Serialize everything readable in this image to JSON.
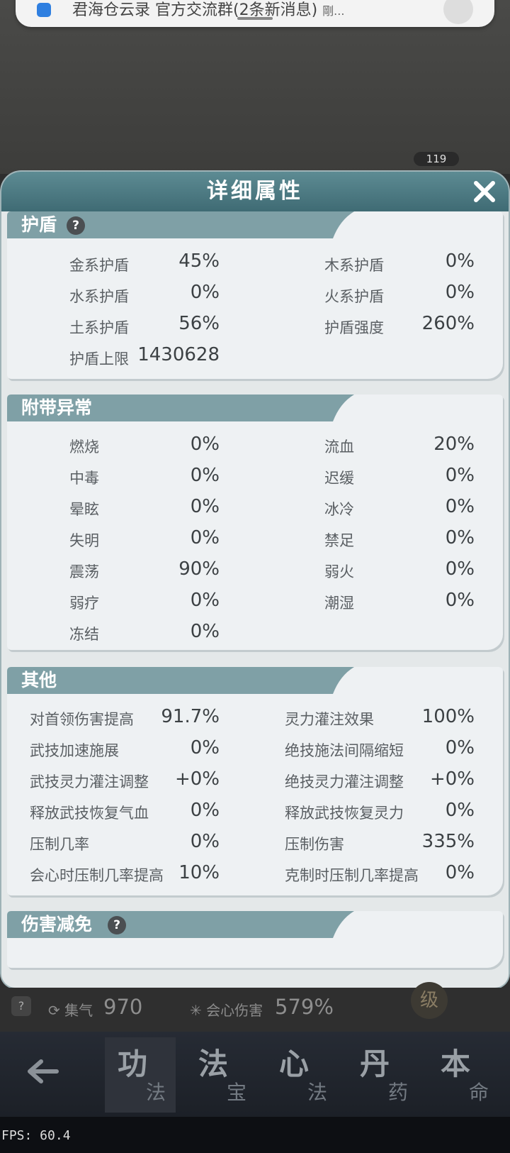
{
  "notification": {
    "text": "君海仓云录 官方交流群(2条新消息)",
    "suffix": "剛..."
  },
  "scene": {
    "badge_count": "119"
  },
  "panel": {
    "title": "详细属性",
    "close_icon": "close-icon"
  },
  "shield": {
    "title": "护盾",
    "help": "?",
    "left": [
      {
        "label": "金系护盾",
        "value": "45%"
      },
      {
        "label": "水系护盾",
        "value": "0%"
      },
      {
        "label": "土系护盾",
        "value": "56%"
      },
      {
        "label": "护盾上限",
        "value": "1430628"
      }
    ],
    "right": [
      {
        "label": "木系护盾",
        "value": "0%"
      },
      {
        "label": "火系护盾",
        "value": "0%"
      },
      {
        "label": "护盾强度",
        "value": "260%"
      }
    ]
  },
  "abnormal": {
    "title": "附带异常",
    "left": [
      {
        "label": "燃烧",
        "value": "0%"
      },
      {
        "label": "中毒",
        "value": "0%"
      },
      {
        "label": "晕眩",
        "value": "0%"
      },
      {
        "label": "失明",
        "value": "0%"
      },
      {
        "label": "震荡",
        "value": "90%"
      },
      {
        "label": "弱疗",
        "value": "0%"
      },
      {
        "label": "冻结",
        "value": "0%"
      }
    ],
    "right": [
      {
        "label": "流血",
        "value": "20%"
      },
      {
        "label": "迟缓",
        "value": "0%"
      },
      {
        "label": "冰冷",
        "value": "0%"
      },
      {
        "label": "禁足",
        "value": "0%"
      },
      {
        "label": "弱火",
        "value": "0%"
      },
      {
        "label": "潮湿",
        "value": "0%"
      }
    ]
  },
  "other": {
    "title": "其他",
    "left": [
      {
        "label": "对首领伤害提高",
        "value": "91.7%"
      },
      {
        "label": "武技加速施展",
        "value": "0%"
      },
      {
        "label": "武技灵力灌注调整",
        "value": "+0%"
      },
      {
        "label": "释放武技恢复气血",
        "value": "0%"
      },
      {
        "label": "压制几率",
        "value": "0%"
      },
      {
        "label": "会心时压制几率提高",
        "value": "10%"
      }
    ],
    "right": [
      {
        "label": "灵力灌注效果",
        "value": "100%"
      },
      {
        "label": "绝技施法间隔缩短",
        "value": "0%"
      },
      {
        "label": "绝技灵力灌注调整",
        "value": "+0%"
      },
      {
        "label": "释放武技恢复灵力",
        "value": "0%"
      },
      {
        "label": "压制伤害",
        "value": "335%"
      },
      {
        "label": "克制时压制几率提高",
        "value": "0%"
      }
    ]
  },
  "damage_reduction": {
    "title": "伤害减免",
    "help": "?"
  },
  "stats_strip": {
    "stat1_label": "集气",
    "stat1_value": "970",
    "stat2_label": "会心伤害",
    "stat2_value": "579%",
    "badge": "级"
  },
  "nav": {
    "tabs": [
      {
        "big": "功",
        "small": "法"
      },
      {
        "big": "法",
        "small": "宝"
      },
      {
        "big": "心",
        "small": "法"
      },
      {
        "big": "丹",
        "small": "药"
      },
      {
        "big": "本",
        "small": "命"
      }
    ]
  },
  "fps": "FPS: 60.4",
  "colors": {
    "header": "#4a7a83",
    "panel": "#e4e8e9",
    "text": "#3c4144"
  }
}
